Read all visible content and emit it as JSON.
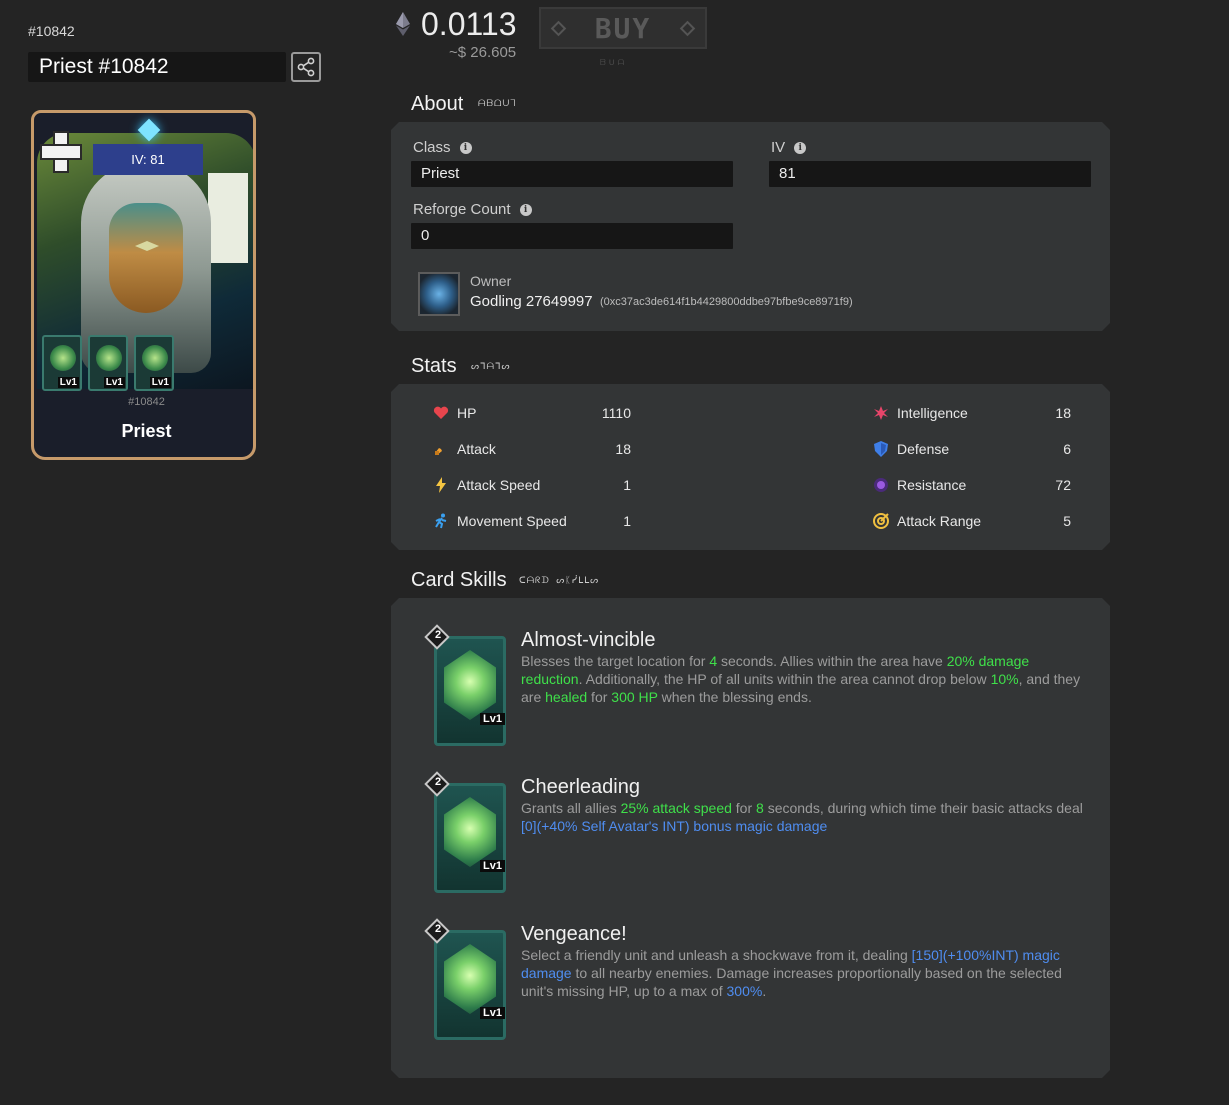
{
  "token_id": "#10842",
  "name": "Priest #10842",
  "card": {
    "iv_badge": "IV: 81",
    "small_id": "#10842",
    "class_name": "Priest",
    "mini_skill_levels": [
      "Lv1",
      "Lv1",
      "Lv1"
    ]
  },
  "price": {
    "eth": "0.0113",
    "usd": "~$ 26.605",
    "buy_label": "BUY",
    "buy_sub": "ᗷᑌᗩ"
  },
  "about": {
    "title": "About",
    "rune": "ᗩᗷᗝᑌᒣ",
    "class_label": "Class",
    "class_value": "Priest",
    "iv_label": "IV",
    "iv_value": "81",
    "reforge_label": "Reforge Count",
    "reforge_value": "0",
    "owner_label": "Owner",
    "owner_name": "Godling 27649997",
    "owner_address": "(0xc37ac3de614f1b4429800ddbe97bfbe9ce8971f9)"
  },
  "stats": {
    "title": "Stats",
    "rune": "ᔕᒣᗩᒣᔕ",
    "left": [
      {
        "label": "HP",
        "value": "1110",
        "icon": "heart-icon",
        "color": "#e8454d"
      },
      {
        "label": "Attack",
        "value": "18",
        "icon": "sword-icon",
        "color": "#f0a030"
      },
      {
        "label": "Attack Speed",
        "value": "1",
        "icon": "lightning-icon",
        "color": "#f5c542"
      },
      {
        "label": "Movement Speed",
        "value": "1",
        "icon": "runner-icon",
        "color": "#3aa0f0"
      }
    ],
    "right": [
      {
        "label": "Intelligence",
        "value": "18",
        "icon": "star-burst-icon",
        "color": "#e8456a"
      },
      {
        "label": "Defense",
        "value": "6",
        "icon": "shield-icon",
        "color": "#3f7fe8"
      },
      {
        "label": "Resistance",
        "value": "72",
        "icon": "orb-icon",
        "color": "#9a5ae0"
      },
      {
        "label": "Attack Range",
        "value": "5",
        "icon": "target-icon",
        "color": "#f0c040"
      }
    ]
  },
  "skills": {
    "title": "Card Skills",
    "rune": "ᑕᗩᖇᗪ ᔕᛕᓰᒪᒪᔕ",
    "items": [
      {
        "name": "Almost-vincible",
        "cost": "2",
        "level": "Lv1",
        "desc": [
          {
            "t": "Blesses the target location for "
          },
          {
            "t": "4",
            "c": "g"
          },
          {
            "t": " seconds. Allies within the area have "
          },
          {
            "t": "20% damage reduction",
            "c": "g"
          },
          {
            "t": ". Additionally, the HP of all units within the area cannot drop below "
          },
          {
            "t": "10%",
            "c": "g"
          },
          {
            "t": ", and they are "
          },
          {
            "t": "healed",
            "c": "g"
          },
          {
            "t": " for "
          },
          {
            "t": "300 HP",
            "c": "g"
          },
          {
            "t": " when the blessing ends."
          }
        ]
      },
      {
        "name": "Cheerleading",
        "cost": "2",
        "level": "Lv1",
        "desc": [
          {
            "t": "Grants all allies "
          },
          {
            "t": "25% attack speed",
            "c": "g"
          },
          {
            "t": " for "
          },
          {
            "t": "8",
            "c": "g"
          },
          {
            "t": " seconds, during which time their basic attacks deal "
          },
          {
            "t": "[0](+40% Self Avatar's INT) bonus magic damage",
            "c": "b"
          }
        ]
      },
      {
        "name": "Vengeance!",
        "cost": "2",
        "level": "Lv1",
        "desc": [
          {
            "t": "Select a friendly unit and unleash a shockwave from it, dealing "
          },
          {
            "t": "[150](+100%INT) magic damage",
            "c": "b"
          },
          {
            "t": " to all nearby enemies. Damage increases proportionally based on the selected unit's missing HP, up to a max of "
          },
          {
            "t": "300%",
            "c": "b"
          },
          {
            "t": "."
          }
        ]
      }
    ]
  }
}
